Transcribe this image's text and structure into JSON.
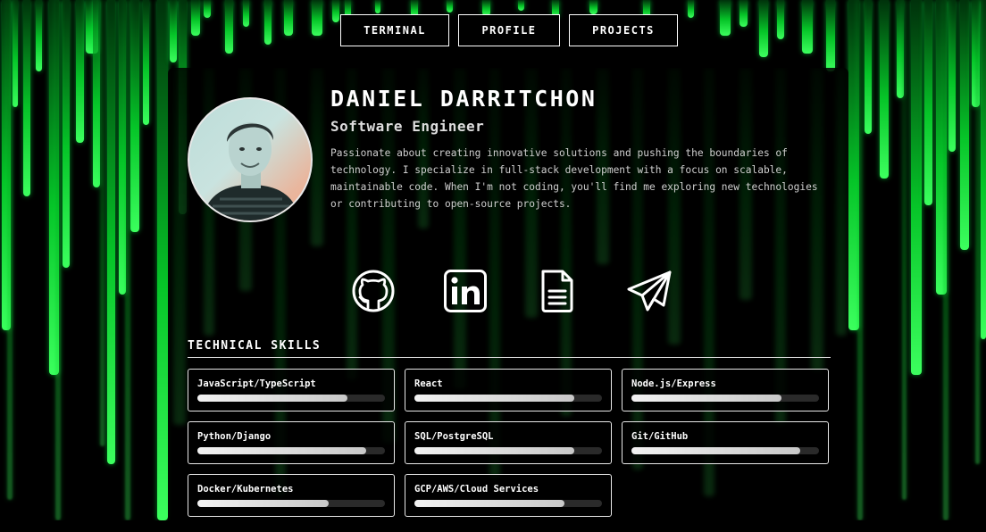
{
  "nav": {
    "items": [
      {
        "label": "TERMINAL"
      },
      {
        "label": "PROFILE"
      },
      {
        "label": "PROJECTS"
      }
    ]
  },
  "profile": {
    "name": "DANIEL DARRITCHON",
    "title": "Software Engineer",
    "bio": "Passionate about creating innovative solutions and pushing the boundaries of technology. I specialize in full-stack development with a focus on scalable, maintainable code. When I'm not coding, you'll find me exploring new technologies or contributing to open-source projects."
  },
  "socials": [
    {
      "icon": "github-icon"
    },
    {
      "icon": "linkedin-icon"
    },
    {
      "icon": "resume-document-icon"
    },
    {
      "icon": "telegram-icon"
    }
  ],
  "skills": {
    "heading": "TECHNICAL SKILLS",
    "items": [
      {
        "name": "JavaScript/TypeScript",
        "level": 0.8
      },
      {
        "name": "React",
        "level": 0.85
      },
      {
        "name": "Node.js/Express",
        "level": 0.8
      },
      {
        "name": "Python/Django",
        "level": 0.9
      },
      {
        "name": "SQL/PostgreSQL",
        "level": 0.85
      },
      {
        "name": "Git/GitHub",
        "level": 0.9
      },
      {
        "name": "Docker/Kubernetes",
        "level": 0.7
      },
      {
        "name": "GCP/AWS/Cloud Services",
        "level": 0.8
      }
    ]
  },
  "colors": {
    "accent": "#00ff41",
    "background": "#000000",
    "text": "#ffffff"
  }
}
